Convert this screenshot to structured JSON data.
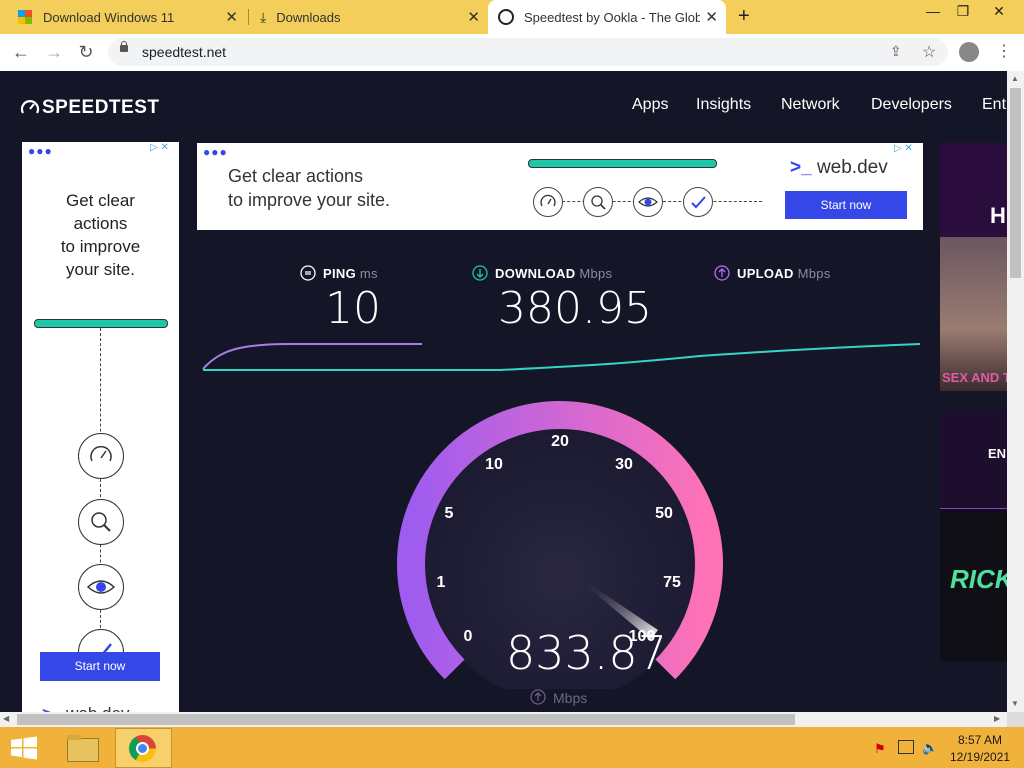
{
  "browser": {
    "tabs": [
      {
        "title": "Download Windows 11",
        "icon": "windows-logo-icon",
        "active": false
      },
      {
        "title": "Downloads",
        "icon": "download-icon",
        "active": false
      },
      {
        "title": "Speedtest by Ookla - The Global",
        "icon": "speedtest-logo-icon",
        "active": true
      }
    ],
    "url": "speedtest.net"
  },
  "site": {
    "logo_text": "SPEEDTEST",
    "nav": [
      "Apps",
      "Insights",
      "Network",
      "Developers",
      "Ent"
    ]
  },
  "ads": {
    "top": {
      "headline": "Get clear actions to improve your site.",
      "line1": "Get clear actions",
      "line2": "to improve your site.",
      "brand": "web.dev",
      "cta": "Start now"
    },
    "left": {
      "line1": "Get clear",
      "line2": "actions",
      "line3": "to improve",
      "line4": "your site.",
      "cta": "Start now",
      "brand": "web.dev"
    },
    "right": {
      "text1": "HB",
      "text2": "SEX AND THE C",
      "text3": "EN",
      "text4": "RICK"
    }
  },
  "results": {
    "ping": {
      "label": "PING",
      "unit": "ms",
      "value": "10"
    },
    "download": {
      "label": "DOWNLOAD",
      "unit": "Mbps",
      "value": "380.95"
    },
    "upload": {
      "label": "UPLOAD",
      "unit": "Mbps"
    }
  },
  "gauge": {
    "ticks": [
      "0",
      "1",
      "5",
      "10",
      "20",
      "30",
      "50",
      "75",
      "100"
    ],
    "value": "833.87",
    "unit": "Mbps",
    "needle_fraction": 0.97
  },
  "taskbar": {
    "time": "8:57 AM",
    "date": "12/19/2021"
  },
  "colors": {
    "tabstrip": "#f3ce5a",
    "page_bg": "#141526",
    "accent_teal": "#1fc7a8",
    "gauge_pink": "#f76fc0",
    "gauge_purple": "#9e5cf0",
    "cta_blue": "#3547e6"
  }
}
